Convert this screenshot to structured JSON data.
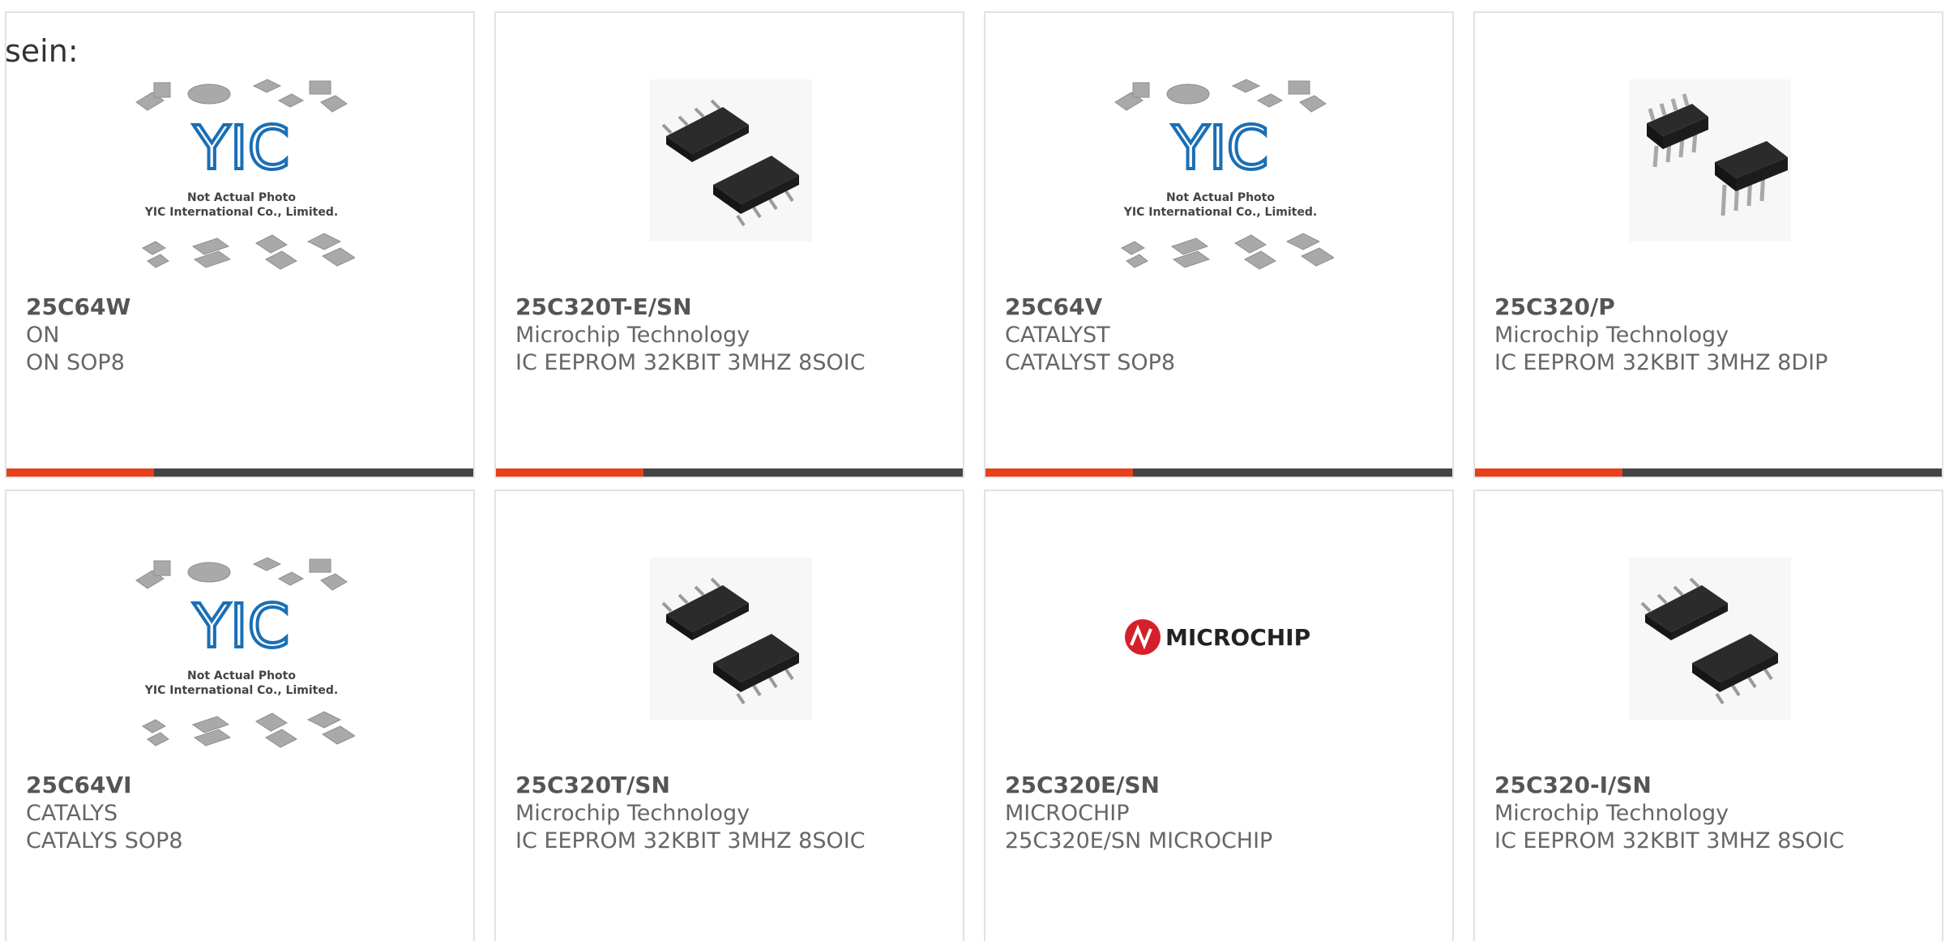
{
  "page": {
    "intro_text": "sein:"
  },
  "placeholder_photo": {
    "logo_text": "YIC",
    "caption_line1": "Not Actual Photo",
    "caption_line2": "YIC International Co., Limited."
  },
  "brand_logo": {
    "text": "MICROCHIP"
  },
  "colors": {
    "accent": "#e8401c",
    "bar_dark": "#444444",
    "card_border": "#e2e2e2",
    "part_text": "#555555",
    "meta_text": "#666666",
    "yic_blue": "#1a6fb5"
  },
  "products": [
    {
      "part": "25C64W",
      "manufacturer": "ON",
      "description": "ON SOP8",
      "image": "placeholder-photo"
    },
    {
      "part": "25C320T-E/SN",
      "manufacturer": "Microchip Technology",
      "description": "IC EEPROM 32KBIT 3MHZ 8SOIC",
      "image": "soic8-chip-photo"
    },
    {
      "part": "25C64V",
      "manufacturer": "CATALYST",
      "description": "CATALYST SOP8",
      "image": "placeholder-photo"
    },
    {
      "part": "25C320/P",
      "manufacturer": "Microchip Technology",
      "description": "IC EEPROM 32KBIT 3MHZ 8DIP",
      "image": "dip8-chip-photo"
    },
    {
      "part": "25C64VI",
      "manufacturer": "CATALYS",
      "description": "CATALYS SOP8",
      "image": "placeholder-photo"
    },
    {
      "part": "25C320T/SN",
      "manufacturer": "Microchip Technology",
      "description": "IC EEPROM 32KBIT 3MHZ 8SOIC",
      "image": "soic8-chip-photo"
    },
    {
      "part": "25C320E/SN",
      "manufacturer": "MICROCHIP",
      "description": "25C320E/SN MICROCHIP",
      "image": "microchip-logo"
    },
    {
      "part": "25C320-I/SN",
      "manufacturer": "Microchip Technology",
      "description": "IC EEPROM 32KBIT 3MHZ 8SOIC",
      "image": "soic8-chip-photo"
    }
  ]
}
